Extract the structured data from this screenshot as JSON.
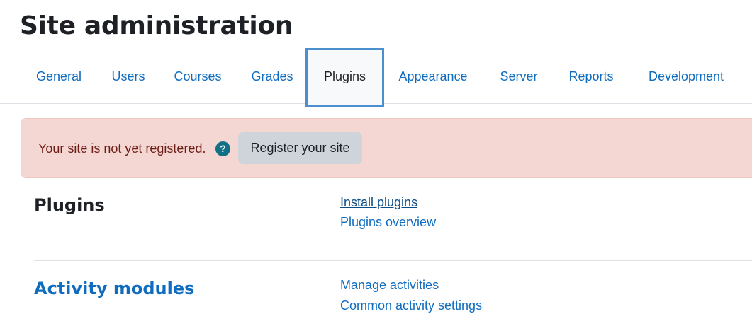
{
  "page": {
    "title": "Site administration"
  },
  "tabs": [
    {
      "label": "General",
      "active": false
    },
    {
      "label": "Users",
      "active": false
    },
    {
      "label": "Courses",
      "active": false
    },
    {
      "label": "Grades",
      "active": false
    },
    {
      "label": "Plugins",
      "active": true
    },
    {
      "label": "Appearance",
      "active": false
    },
    {
      "label": "Server",
      "active": false
    },
    {
      "label": "Reports",
      "active": false
    },
    {
      "label": "Development",
      "active": false
    }
  ],
  "alert": {
    "message": "Your site is not yet registered.",
    "help_icon": "question-circle-icon",
    "button_label": "Register your site"
  },
  "sections": [
    {
      "heading": "Plugins",
      "links": [
        "Install plugins",
        "Plugins overview"
      ]
    },
    {
      "heading": "Activity modules",
      "links": [
        "Manage activities",
        "Common activity settings"
      ]
    }
  ],
  "colors": {
    "link": "#0f6cbf",
    "alert_bg": "#f4d6d2",
    "alert_text": "#6e1d16",
    "active_tab_border": "#4b8fcf",
    "button_bg": "#ced4da",
    "help_icon_bg": "#0f7086"
  }
}
